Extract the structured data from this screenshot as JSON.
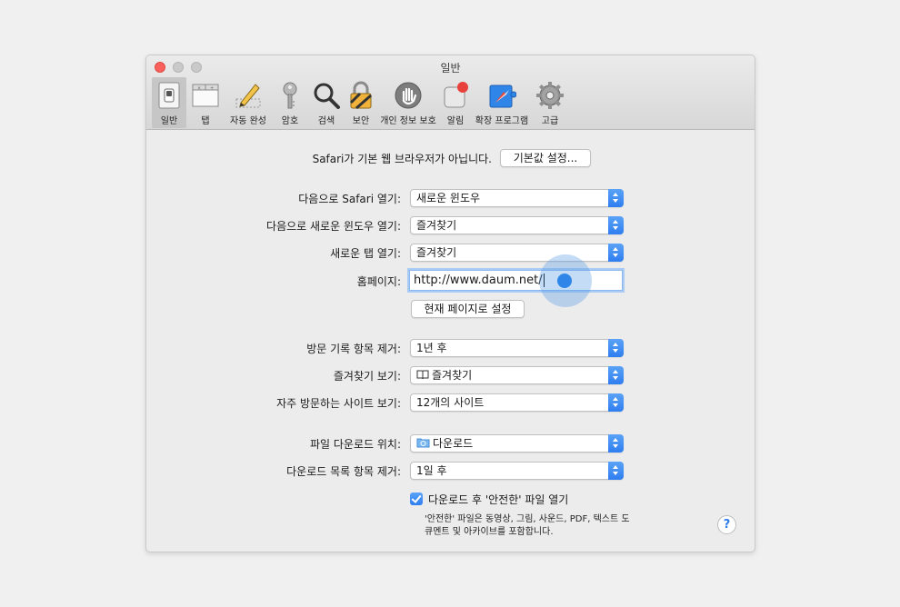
{
  "window": {
    "title": "일반"
  },
  "toolbar": {
    "items": [
      {
        "label": "일반",
        "icon": "general-switch-icon"
      },
      {
        "label": "탭",
        "icon": "tabs-icon"
      },
      {
        "label": "자동 완성",
        "icon": "autofill-pencil-icon"
      },
      {
        "label": "암호",
        "icon": "key-icon"
      },
      {
        "label": "검색",
        "icon": "magnifier-icon"
      },
      {
        "label": "보안",
        "icon": "padlock-icon"
      },
      {
        "label": "개인 정보 보호",
        "icon": "hand-icon"
      },
      {
        "label": "알림",
        "icon": "notification-badge-icon"
      },
      {
        "label": "확장 프로그램",
        "icon": "extensions-puzzle-icon"
      },
      {
        "label": "고급",
        "icon": "gear-icon"
      }
    ]
  },
  "default_browser": {
    "message": "Safari가 기본 웹 브라우저가 아닙니다.",
    "button": "기본값 설정..."
  },
  "settings": {
    "open_with": {
      "label": "다음으로 Safari 열기:",
      "value": "새로운 윈도우"
    },
    "new_windows": {
      "label": "다음으로 새로운 윈도우 열기:",
      "value": "즐겨찾기"
    },
    "new_tabs": {
      "label": "새로운 탭 열기:",
      "value": "즐겨찾기"
    },
    "homepage": {
      "label": "홈페이지:",
      "value": "http://www.daum.net/",
      "set_current": "현재 페이지로 설정"
    },
    "remove_history": {
      "label": "방문 기록 항목 제거:",
      "value": "1년 후"
    },
    "favorites_shows": {
      "label": "즐겨찾기 보기:",
      "value": "즐겨찾기"
    },
    "top_sites": {
      "label": "자주 방문하는 사이트 보기:",
      "value": "12개의 사이트"
    },
    "download_location": {
      "label": "파일 다운로드 위치:",
      "value": "다운로드"
    },
    "remove_downloads": {
      "label": "다운로드 목록 항목 제거:",
      "value": "1일 후"
    },
    "open_safe": {
      "label": "다운로드 후 '안전한' 파일 열기",
      "checked": true,
      "note1": "'안전한' 파일은 동영상, 그림, 사운드, PDF, 텍스트 도",
      "note2": "큐멘트 및 아카이브를 포함합니다."
    }
  },
  "help": {
    "label": "?"
  },
  "colors": {
    "accent": "#2f7ef0",
    "close": "#fc605b"
  }
}
